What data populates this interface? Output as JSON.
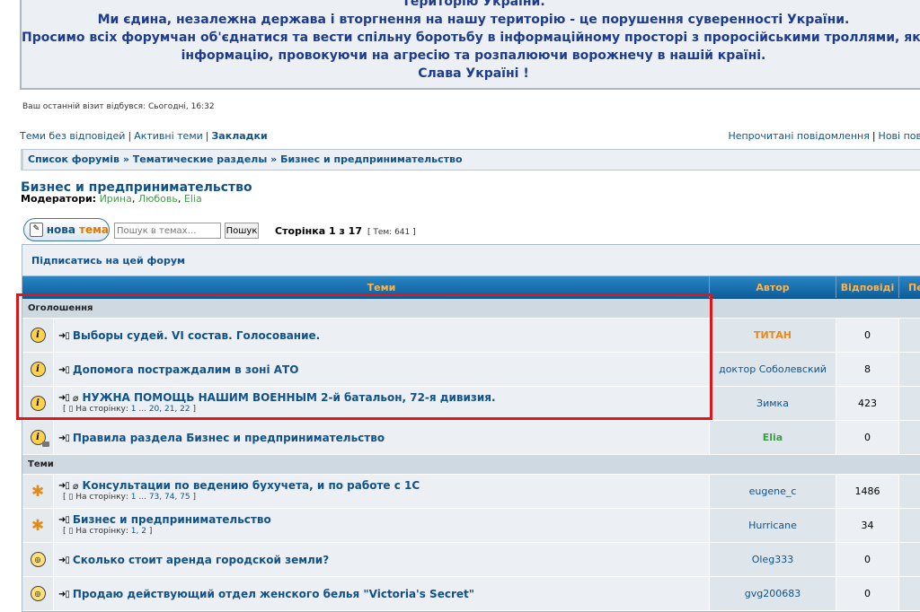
{
  "announcement": {
    "lines": [
      "Територію України.",
      "Ми єдина, незалежна держава і вторгнення на нашу територію - це порушення суверенності України.",
      "Просимо всіх форумчан об'єднатися та вести спільну боротьбу в інформаційному просторі з проросійськими троллями, які п",
      "інформацію, провокуючи на агресію та розпалюючи ворожнечу в нашій країні.",
      "Слава Україні !"
    ]
  },
  "last_visit": "Ваш останній візит відбувся: Сьогодні, 16:32",
  "quick_links": {
    "no_replies": "Теми без відповідей",
    "active": "Активні теми",
    "bookmarks": "Закладки",
    "unread": "Непрочитані повідомлення",
    "new": "Нові пов"
  },
  "breadcrumb": {
    "forum_list": "Список форумів",
    "sep": "»",
    "cat1": "Тематические разделы",
    "cat2": "Бизнес и предпринимательство"
  },
  "forum": {
    "title": "Бизнес и предпринимательство",
    "moderators_label": "Модератори:",
    "moderators": [
      "Ирина",
      "Любовь",
      "Elia"
    ]
  },
  "toolbar": {
    "new_topic_part1": "нова",
    "new_topic_part2": "тема",
    "search_placeholder": "Пошук в темах…",
    "search_button": "Пошук",
    "pagination": "Сторінка 1 з 17",
    "topic_count": "[ Тем: 641 ]"
  },
  "table": {
    "subscribe": "Підписатись на цей форум",
    "headers": {
      "topics": "Теми",
      "author": "Автор",
      "replies": "Відповіді",
      "extra": "Пе"
    },
    "section_announcements": "Оголошення",
    "section_topics": "Теми",
    "goto_label": "На сторінку:",
    "announcements": [
      {
        "title": "Выборы судей. VI состав. Голосование.",
        "author": "ТИТАН",
        "replies": "0",
        "icon": "announcement-icon",
        "pages": ""
      },
      {
        "title": "Допомога постраждалим в зоні АТО",
        "author": "доктор Соболевский",
        "replies": "8",
        "icon": "announcement-icon",
        "pages": ""
      },
      {
        "title": "НУЖНА ПОМОЩЬ НАШИМ ВОЕННЫМ 2-й батальон, 72-я дивизия.",
        "author": "Зимка",
        "replies": "423",
        "icon": "announcement-icon",
        "pages": "1 ... 20, 21, 22"
      }
    ],
    "sticky": {
      "title": "Правила раздела Бизнес и предпринимательство",
      "author": "Elia",
      "replies": "0"
    },
    "topics": [
      {
        "title": "Консультации по ведению бухучета, и по работе с 1С",
        "author": "eugene_c",
        "replies": "1486",
        "pages": "1 ... 73, 74, 75"
      },
      {
        "title": "Бизнес и предпринимательство",
        "author": "Hurricane",
        "replies": "34",
        "pages": "1, 2"
      },
      {
        "title": "Сколько стоит аренда городской земли?",
        "author": "Oleg333",
        "replies": "0",
        "pages": ""
      },
      {
        "title": "Продаю действующий отдел женского белья \"Victoria's Secret\"",
        "author": "gvg200683",
        "replies": "0",
        "pages": ""
      }
    ]
  }
}
